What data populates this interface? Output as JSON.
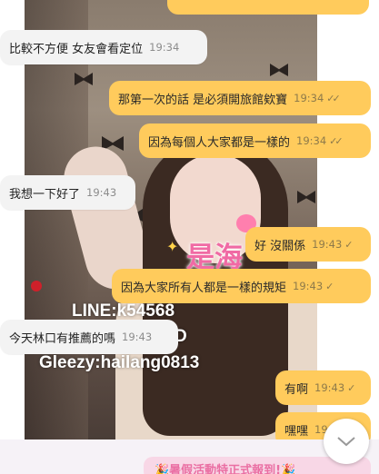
{
  "colors": {
    "incoming_bubble": "#f3f3f3",
    "outgoing_bubble": "#ffcb5c",
    "banner": "#f8d7e6",
    "banner_text": "#ea6fa3"
  },
  "photo": {
    "watermark_line": "LINE:k54568",
    "watermark_partial": "D",
    "watermark_gleezy": "Gleezy:hailang0813",
    "overlay_text": "是海"
  },
  "messages": [
    {
      "direction": "in",
      "text": "比較不方便 女友會看定位",
      "time": "19:34",
      "ticks": ""
    },
    {
      "direction": "out",
      "text": "那第一次的話 是必須開旅館欸寶",
      "time": "19:34",
      "ticks": "✓✓"
    },
    {
      "direction": "out",
      "text": "因為每個人大家都是一樣的",
      "time": "19:34",
      "ticks": "✓✓"
    },
    {
      "direction": "in",
      "text": "我想一下好了",
      "time": "19:43",
      "ticks": ""
    },
    {
      "direction": "out",
      "text": "好 沒關係",
      "time": "19:43",
      "ticks": "✓"
    },
    {
      "direction": "out",
      "text": "因為大家所有人都是一樣的規矩",
      "time": "19:43",
      "ticks": "✓"
    },
    {
      "direction": "in",
      "text": "今天林口有推薦的嗎",
      "time": "19:43",
      "ticks": ""
    },
    {
      "direction": "out",
      "text": "有啊",
      "time": "19:43",
      "ticks": "✓"
    },
    {
      "direction": "out",
      "text": "嘿嘿",
      "time": "19",
      "ticks": ""
    }
  ],
  "banner": {
    "text": "🎉暑假活動特正式報到!🎉"
  },
  "scroll_button": {
    "icon": "chevron-down-icon"
  }
}
